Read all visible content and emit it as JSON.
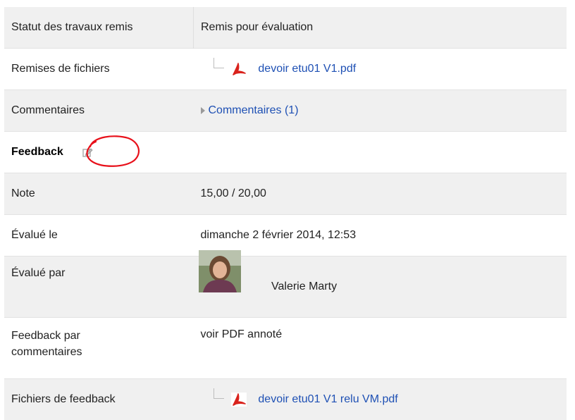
{
  "rows": {
    "status": {
      "label": "Statut des travaux remis",
      "value": "Remis pour évaluation"
    },
    "file_submissions": {
      "label": "Remises de fichiers",
      "file": "devoir etu01 V1.pdf"
    },
    "comments": {
      "label": "Commentaires",
      "link": "Commentaires (1)"
    },
    "feedback_header": {
      "label": "Feedback",
      "icon": "edit-icon"
    },
    "grade": {
      "label": "Note",
      "value": "15,00 / 20,00"
    },
    "graded_on": {
      "label": "Évalué le",
      "value": "dimanche 2 février 2014, 12:53"
    },
    "graded_by": {
      "label": "Évalué par",
      "name": "Valerie Marty"
    },
    "feedback_comments": {
      "label_line1": "Feedback par",
      "label_line2": "commentaires",
      "value": "voir PDF annoté"
    },
    "feedback_files": {
      "label": "Fichiers de feedback",
      "file": "devoir etu01 V1 relu VM.pdf"
    }
  },
  "colors": {
    "link": "#1e50b4",
    "row_shade": "#f0f0f0",
    "pdf_red": "#d9221c",
    "annotation_red": "#e8101a"
  }
}
